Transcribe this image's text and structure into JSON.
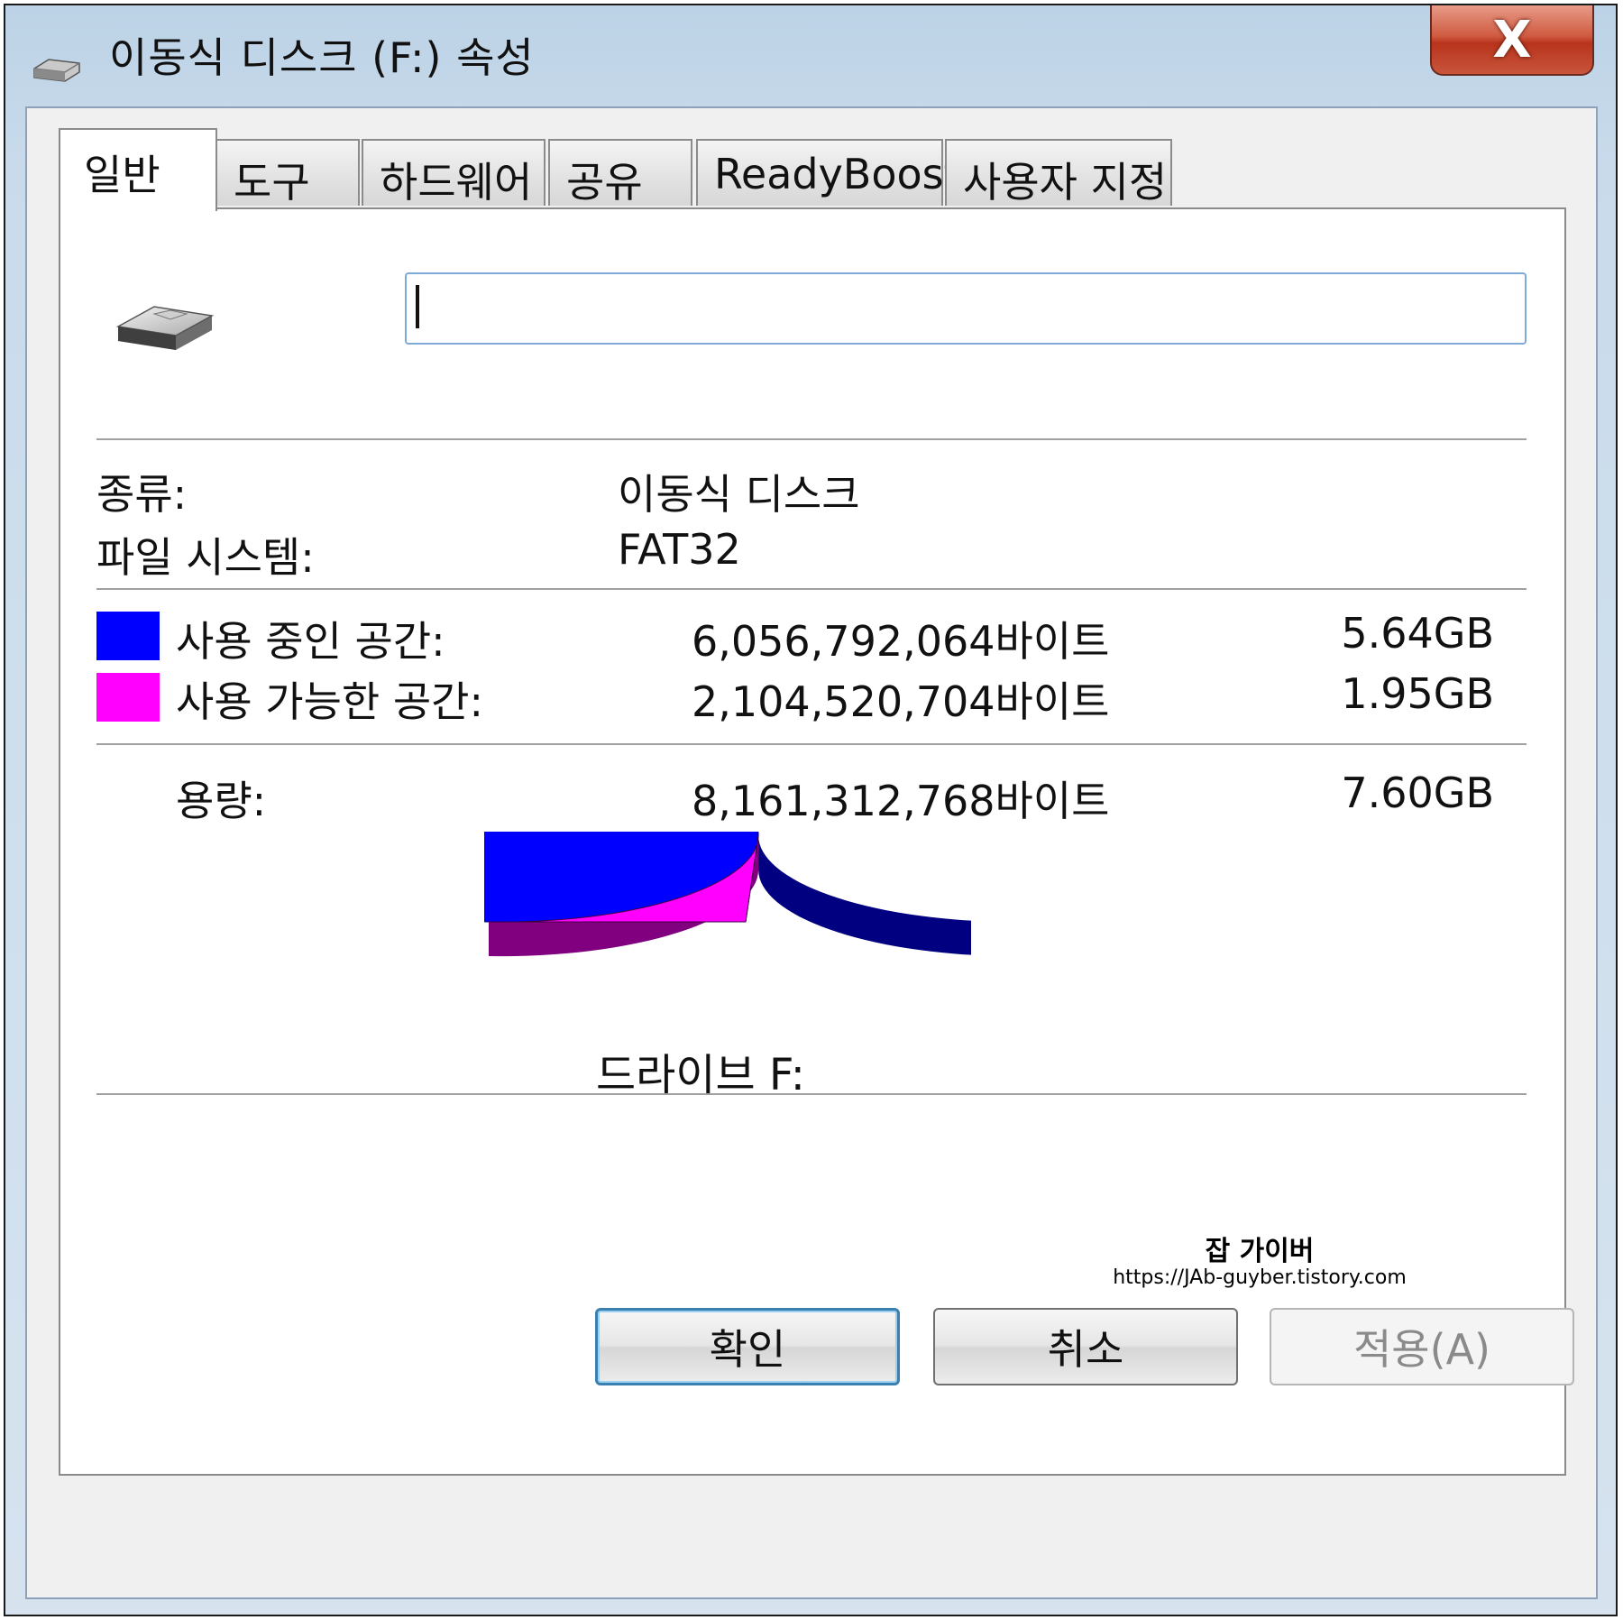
{
  "window": {
    "title": "이동식 디스크 (F:) 속성",
    "close_label": "X"
  },
  "tabs": [
    {
      "label": "일반",
      "active": true
    },
    {
      "label": "도구"
    },
    {
      "label": "하드웨어"
    },
    {
      "label": "공유"
    },
    {
      "label": "ReadyBoost"
    },
    {
      "label": "사용자 지정"
    }
  ],
  "general": {
    "name_value": "",
    "type_label": "종류:",
    "type_value": "이동식 디스크",
    "fs_label": "파일 시스템:",
    "fs_value": "FAT32",
    "used": {
      "label": "사용 중인 공간:",
      "bytes": "6,056,792,064바이트",
      "size": "5.64GB",
      "color": "#0000ff"
    },
    "free": {
      "label": "사용 가능한 공간:",
      "bytes": "2,104,520,704바이트",
      "size": "1.95GB",
      "color": "#ff00ff"
    },
    "capacity": {
      "label": "용량:",
      "bytes": "8,161,312,768바이트",
      "size": "7.60GB"
    },
    "drive_label": "드라이브 F:"
  },
  "chart_data": {
    "type": "pie",
    "values": [
      6056792064,
      2104520704
    ],
    "colors": [
      "#0000ff",
      "#ff00ff"
    ]
  },
  "watermark": {
    "title": "잡 가이버",
    "url": "https://JAb-guyber.tistory.com"
  },
  "buttons": {
    "ok": "확인",
    "cancel": "취소",
    "apply": "적용(A)"
  }
}
